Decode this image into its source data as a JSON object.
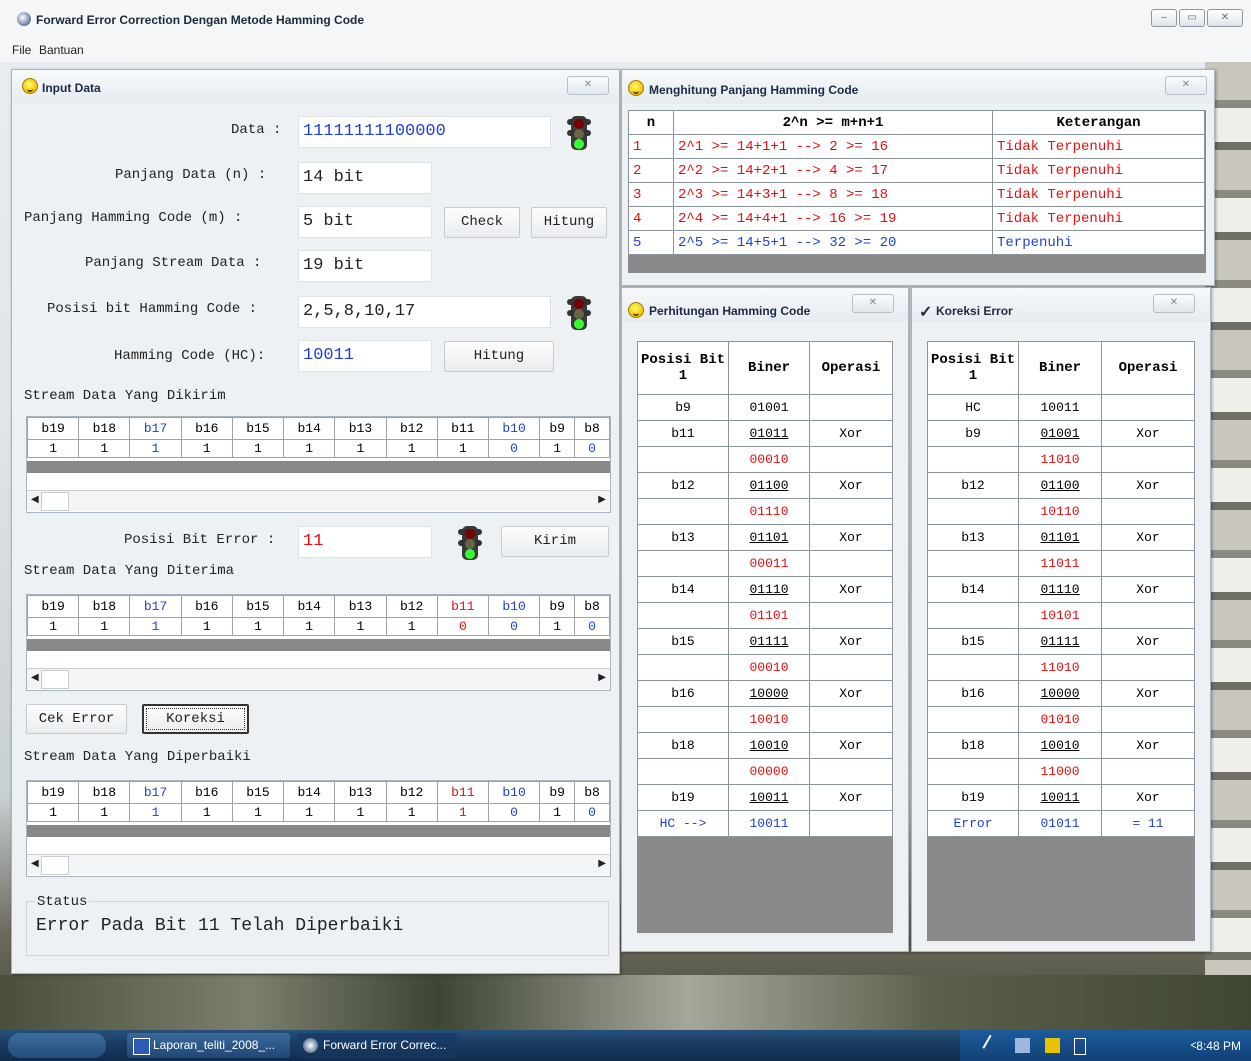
{
  "app": {
    "title": "Forward Error Correction Dengan Metode Hamming Code"
  },
  "window_controls": {
    "minimize": "▭",
    "maximize": "▭",
    "close": "✕"
  },
  "menu": [
    "File",
    "Bantuan"
  ],
  "input_panel": {
    "title": "Input Data",
    "close_label": "✕",
    "data_label": "Data :",
    "data_value": "11111111100000",
    "panjang_data_label": "Panjang Data (n) :",
    "panjang_data_value": "14 bit",
    "panjang_hc_label": "Panjang Hamming Code (m) :",
    "panjang_hc_value": "5 bit",
    "check_button": "Check",
    "hitung_button": "Hitung",
    "panjang_stream_label": "Panjang Stream Data :",
    "panjang_stream_value": "19 bit",
    "posisi_hc_label": "Posisi bit Hamming Code :",
    "posisi_hc_value": "2,5,8,10,17",
    "hc_label": "Hamming Code (HC):",
    "hc_value": "10011",
    "hitung2_button": "Hitung",
    "stream_kirim_label": "Stream Data Yang Dikirim",
    "posisi_error_label": "Posisi Bit Error :",
    "posisi_error_value": "11",
    "kirim_button": "Kirim",
    "stream_terima_label": "Stream Data Yang Diterima",
    "cek_error_button": "Cek Error",
    "koreksi_button": "Koreksi",
    "stream_perbaiki_label": "Stream Data Yang Diperbaiki",
    "status_label": "Status",
    "status_value": "Error Pada Bit 11 Telah Diperbaiki"
  },
  "stream_headers": [
    "b19",
    "b18",
    "b17",
    "b16",
    "b15",
    "b14",
    "b13",
    "b12",
    "b11",
    "b10",
    "b9",
    "b8"
  ],
  "stream_kirim": [
    "1",
    "1",
    "1",
    "1",
    "1",
    "1",
    "1",
    "1",
    "1",
    "0",
    "1",
    "0"
  ],
  "stream_terima": [
    "1",
    "1",
    "1",
    "1",
    "1",
    "1",
    "1",
    "1",
    "0",
    "0",
    "1",
    "0"
  ],
  "stream_perbaiki": [
    "1",
    "1",
    "1",
    "1",
    "1",
    "1",
    "1",
    "1",
    "1",
    "0",
    "1",
    "0"
  ],
  "scroll_arrows": {
    "left": "◀",
    "right": "▶"
  },
  "hamming_length_panel": {
    "title": "Menghitung Panjang Hamming Code",
    "close_label": "✕",
    "headers": [
      "n",
      "2^n >= m+n+1",
      "Keterangan"
    ],
    "rows": [
      {
        "n": "1",
        "formula": "2^1 >= 14+1+1 --> 2 >= 16",
        "ket": "Tidak Terpenuhi"
      },
      {
        "n": "2",
        "formula": "2^2 >= 14+2+1 --> 4 >= 17",
        "ket": "Tidak Terpenuhi"
      },
      {
        "n": "3",
        "formula": "2^3 >= 14+3+1 --> 8 >= 18",
        "ket": "Tidak Terpenuhi"
      },
      {
        "n": "4",
        "formula": "2^4 >= 14+4+1 --> 16 >= 19",
        "ket": "Tidak Terpenuhi"
      },
      {
        "n": "5",
        "formula": "2^5 >= 14+5+1 --> 32 >= 20",
        "ket": "Terpenuhi"
      }
    ]
  },
  "perhitungan_panel": {
    "title": "Perhitungan Hamming Code",
    "close_label": "✕",
    "headers": [
      "Posisi Bit 1",
      "Biner",
      "Operasi"
    ],
    "rows": [
      [
        "b9",
        "01001",
        ""
      ],
      [
        "b11",
        "01011",
        "Xor"
      ],
      [
        "",
        "00010",
        ""
      ],
      [
        "b12",
        "01100",
        "Xor"
      ],
      [
        "",
        "01110",
        ""
      ],
      [
        "b13",
        "01101",
        "Xor"
      ],
      [
        "",
        "00011",
        ""
      ],
      [
        "b14",
        "01110",
        "Xor"
      ],
      [
        "",
        "01101",
        ""
      ],
      [
        "b15",
        "01111",
        "Xor"
      ],
      [
        "",
        "00010",
        ""
      ],
      [
        "b16",
        "10000",
        "Xor"
      ],
      [
        "",
        "10010",
        ""
      ],
      [
        "b18",
        "10010",
        "Xor"
      ],
      [
        "",
        "00000",
        ""
      ],
      [
        "b19",
        "10011",
        "Xor"
      ],
      [
        "HC -->",
        "10011",
        ""
      ]
    ]
  },
  "koreksi_panel": {
    "title": "Koreksi Error",
    "check_mark": "✓",
    "close_label": "✕",
    "headers": [
      "Posisi Bit 1",
      "Biner",
      "Operasi"
    ],
    "rows": [
      [
        "HC",
        "10011",
        ""
      ],
      [
        "b9",
        "01001",
        "Xor"
      ],
      [
        "",
        "11010",
        ""
      ],
      [
        "b12",
        "01100",
        "Xor"
      ],
      [
        "",
        "10110",
        ""
      ],
      [
        "b13",
        "01101",
        "Xor"
      ],
      [
        "",
        "11011",
        ""
      ],
      [
        "b14",
        "01110",
        "Xor"
      ],
      [
        "",
        "10101",
        ""
      ],
      [
        "b15",
        "01111",
        "Xor"
      ],
      [
        "",
        "11010",
        ""
      ],
      [
        "b16",
        "10000",
        "Xor"
      ],
      [
        "",
        "01010",
        ""
      ],
      [
        "b18",
        "10010",
        "Xor"
      ],
      [
        "",
        "11000",
        ""
      ],
      [
        "b19",
        "10011",
        "Xor"
      ],
      [
        "Error",
        "01011",
        "= 11"
      ]
    ]
  },
  "taskbar": {
    "tasks": [
      "Laporan_teliti_2008_...",
      "Forward Error Correc..."
    ],
    "clock": "8:48 PM",
    "tray_arrow": "<"
  },
  "colors": {
    "blue": "#1f3fd8",
    "red": "#e01010",
    "taskbar": "#1a3b62"
  }
}
